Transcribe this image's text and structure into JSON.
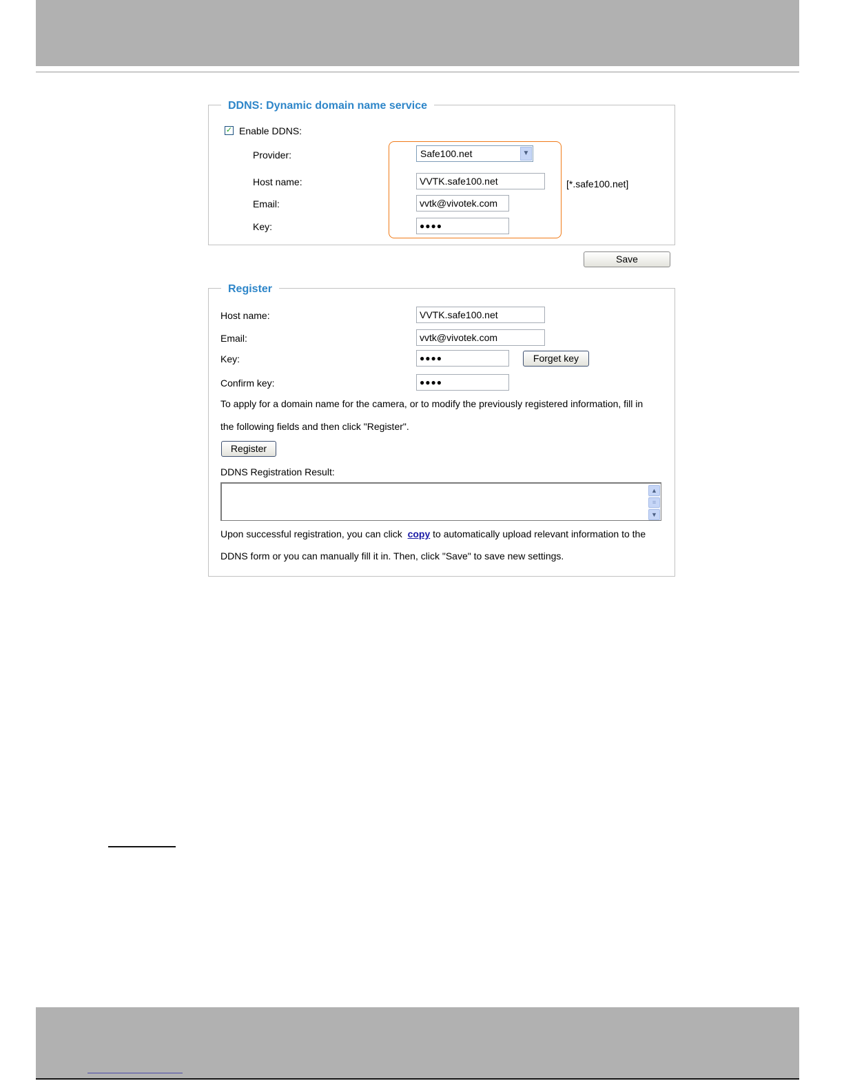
{
  "ddns": {
    "legend": "DDNS: Dynamic domain name service",
    "enable_label": "Enable DDNS:",
    "enable_checked": true,
    "provider_label": "Provider:",
    "provider_value": "Safe100.net",
    "host_label": "Host name:",
    "host_value": "VVTK.safe100.net",
    "host_hint": "[*.safe100.net]",
    "email_label": "Email:",
    "email_value": "vvtk@vivotek.com",
    "key_label": "Key:",
    "key_value": "●●●●",
    "save_label": "Save"
  },
  "register": {
    "legend": "Register",
    "host_label": "Host name:",
    "host_value": "VVTK.safe100.net",
    "email_label": "Email:",
    "email_value": "vvtk@vivotek.com",
    "key_label": "Key:",
    "key_value": "●●●●",
    "forget_key_label": "Forget key",
    "confirm_label": "Confirm key:",
    "confirm_value": "●●●●",
    "instructions_line1": "To apply for a domain name for the camera, or to modify the previously registered information, fill in",
    "instructions_line2": "the following fields and then click \"Register\".",
    "register_label": "Register",
    "result_label": "DDNS Registration Result:",
    "result_value": "",
    "footer_prefix": "Upon successful registration, you can click",
    "copy_link": "copy",
    "footer_suffix": "to automatically upload relevant information to the",
    "footer_line2": "DDNS form or you can manually fill it in. Then, click \"Save\" to save new settings."
  },
  "icons": {
    "checkbox_check": "checkmark-icon",
    "dropdown": "chevron-down-icon",
    "scroll_up": "chevron-up-icon",
    "scroll_down": "chevron-down-icon"
  },
  "colors": {
    "legend_text": "#2e86c9",
    "highlight_border": "#f07a17",
    "page_band": "#b1b1b1",
    "link": "#1a1aa6"
  }
}
